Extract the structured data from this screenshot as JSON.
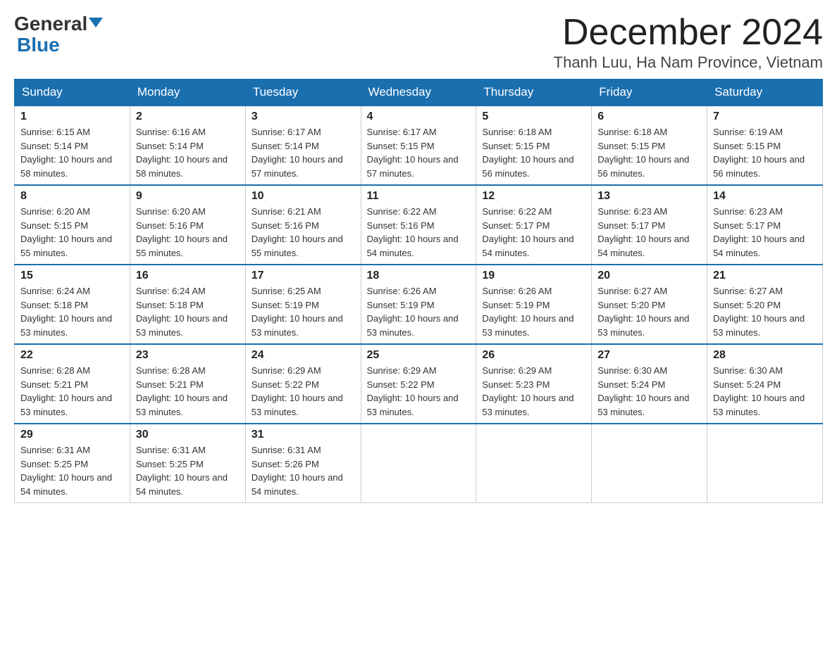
{
  "header": {
    "logo_line1": "General",
    "logo_line2": "Blue",
    "month": "December 2024",
    "location": "Thanh Luu, Ha Nam Province, Vietnam"
  },
  "days_of_week": [
    "Sunday",
    "Monday",
    "Tuesday",
    "Wednesday",
    "Thursday",
    "Friday",
    "Saturday"
  ],
  "weeks": [
    [
      {
        "day": "1",
        "sunrise": "6:15 AM",
        "sunset": "5:14 PM",
        "daylight": "10 hours and 58 minutes."
      },
      {
        "day": "2",
        "sunrise": "6:16 AM",
        "sunset": "5:14 PM",
        "daylight": "10 hours and 58 minutes."
      },
      {
        "day": "3",
        "sunrise": "6:17 AM",
        "sunset": "5:14 PM",
        "daylight": "10 hours and 57 minutes."
      },
      {
        "day": "4",
        "sunrise": "6:17 AM",
        "sunset": "5:15 PM",
        "daylight": "10 hours and 57 minutes."
      },
      {
        "day": "5",
        "sunrise": "6:18 AM",
        "sunset": "5:15 PM",
        "daylight": "10 hours and 56 minutes."
      },
      {
        "day": "6",
        "sunrise": "6:18 AM",
        "sunset": "5:15 PM",
        "daylight": "10 hours and 56 minutes."
      },
      {
        "day": "7",
        "sunrise": "6:19 AM",
        "sunset": "5:15 PM",
        "daylight": "10 hours and 56 minutes."
      }
    ],
    [
      {
        "day": "8",
        "sunrise": "6:20 AM",
        "sunset": "5:15 PM",
        "daylight": "10 hours and 55 minutes."
      },
      {
        "day": "9",
        "sunrise": "6:20 AM",
        "sunset": "5:16 PM",
        "daylight": "10 hours and 55 minutes."
      },
      {
        "day": "10",
        "sunrise": "6:21 AM",
        "sunset": "5:16 PM",
        "daylight": "10 hours and 55 minutes."
      },
      {
        "day": "11",
        "sunrise": "6:22 AM",
        "sunset": "5:16 PM",
        "daylight": "10 hours and 54 minutes."
      },
      {
        "day": "12",
        "sunrise": "6:22 AM",
        "sunset": "5:17 PM",
        "daylight": "10 hours and 54 minutes."
      },
      {
        "day": "13",
        "sunrise": "6:23 AM",
        "sunset": "5:17 PM",
        "daylight": "10 hours and 54 minutes."
      },
      {
        "day": "14",
        "sunrise": "6:23 AM",
        "sunset": "5:17 PM",
        "daylight": "10 hours and 54 minutes."
      }
    ],
    [
      {
        "day": "15",
        "sunrise": "6:24 AM",
        "sunset": "5:18 PM",
        "daylight": "10 hours and 53 minutes."
      },
      {
        "day": "16",
        "sunrise": "6:24 AM",
        "sunset": "5:18 PM",
        "daylight": "10 hours and 53 minutes."
      },
      {
        "day": "17",
        "sunrise": "6:25 AM",
        "sunset": "5:19 PM",
        "daylight": "10 hours and 53 minutes."
      },
      {
        "day": "18",
        "sunrise": "6:26 AM",
        "sunset": "5:19 PM",
        "daylight": "10 hours and 53 minutes."
      },
      {
        "day": "19",
        "sunrise": "6:26 AM",
        "sunset": "5:19 PM",
        "daylight": "10 hours and 53 minutes."
      },
      {
        "day": "20",
        "sunrise": "6:27 AM",
        "sunset": "5:20 PM",
        "daylight": "10 hours and 53 minutes."
      },
      {
        "day": "21",
        "sunrise": "6:27 AM",
        "sunset": "5:20 PM",
        "daylight": "10 hours and 53 minutes."
      }
    ],
    [
      {
        "day": "22",
        "sunrise": "6:28 AM",
        "sunset": "5:21 PM",
        "daylight": "10 hours and 53 minutes."
      },
      {
        "day": "23",
        "sunrise": "6:28 AM",
        "sunset": "5:21 PM",
        "daylight": "10 hours and 53 minutes."
      },
      {
        "day": "24",
        "sunrise": "6:29 AM",
        "sunset": "5:22 PM",
        "daylight": "10 hours and 53 minutes."
      },
      {
        "day": "25",
        "sunrise": "6:29 AM",
        "sunset": "5:22 PM",
        "daylight": "10 hours and 53 minutes."
      },
      {
        "day": "26",
        "sunrise": "6:29 AM",
        "sunset": "5:23 PM",
        "daylight": "10 hours and 53 minutes."
      },
      {
        "day": "27",
        "sunrise": "6:30 AM",
        "sunset": "5:24 PM",
        "daylight": "10 hours and 53 minutes."
      },
      {
        "day": "28",
        "sunrise": "6:30 AM",
        "sunset": "5:24 PM",
        "daylight": "10 hours and 53 minutes."
      }
    ],
    [
      {
        "day": "29",
        "sunrise": "6:31 AM",
        "sunset": "5:25 PM",
        "daylight": "10 hours and 54 minutes."
      },
      {
        "day": "30",
        "sunrise": "6:31 AM",
        "sunset": "5:25 PM",
        "daylight": "10 hours and 54 minutes."
      },
      {
        "day": "31",
        "sunrise": "6:31 AM",
        "sunset": "5:26 PM",
        "daylight": "10 hours and 54 minutes."
      },
      null,
      null,
      null,
      null
    ]
  ]
}
